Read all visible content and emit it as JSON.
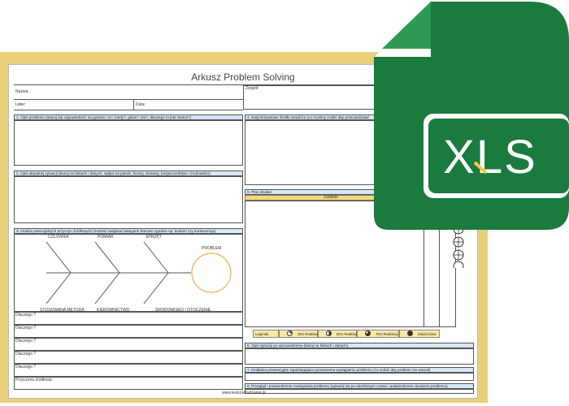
{
  "document": {
    "title": "Arkusz Problem Solving",
    "fields": {
      "nazwa": "Nazwa:",
      "zespol": "Zespół:",
      "lider": "Lider:",
      "data": "Data:"
    },
    "sections": {
      "s1": "1. Opis problemu (stanuj się odpowiedzieć na pytania: co?, kiedy?, gdzie?, kto?, dlaczego to jest istotne?)",
      "s2": "2. Opis aktualnej sytuacji (bazuj na faktach i danych, wpływ na jakość, koszty, dostawy, bezpieczeństwo i środowisko)",
      "s3": "3. Analiza potencjalnych przyczyn źródłowych (możesz nadpisać kategorie bazowe zgodnie np. kudzeń czy konkurencja)",
      "s4": "4. Natychmiastowe środki zaradcze (co musimy zrobić aby przeciwdziałać",
      "s5": "5. Plan działań",
      "s6": "6. Opis sytuacji po wprowadzeniu (bazuj na faktach i danych)",
      "s7": "7. Działania prewencyjne zapobiegające ponownemu wystąpieniu problemu (co zrobić aby problem nie wracał)",
      "s8": "8. Przegląd i potwierdzenie rozwiązania problemu (upewnij się po określonym czasie i potwierdzenie usunięcia problemu)"
    },
    "fishbone": {
      "top_labels": [
        "CZŁOWIEK",
        "POMIAR",
        "SPRZĘT"
      ],
      "bottom_labels": [
        "STOSOWANA METODA",
        "KIEROWNICTWO",
        "ŚRODOWISKO I OTOCZENIE"
      ],
      "head_label": "PROBLEM"
    },
    "why_rows": [
      "Dlaczego ?",
      "Dlaczego ?",
      "Dlaczego ?",
      "Dlaczego ?",
      "Dlaczego ?"
    ],
    "root_cause": "Przyczyna źródłowa:",
    "plan": {
      "header": "Zadanie",
      "legend": [
        "Legenda",
        "25% Realizacji",
        "50% Realizacji",
        "75% Realizacji",
        "Zakończone"
      ]
    },
    "footer_link": "www.leanzarzadzanie.pl"
  },
  "file_icon": {
    "label": "XLS",
    "color_dark": "#1b7a3e",
    "color_light": "#22a455",
    "accent": "#f2c94c"
  },
  "colors": {
    "frame": "#e9cf7a",
    "section_header": "#d6e7f6",
    "plan_header": "#f4d87a",
    "fishbone_head": "#e8b04a"
  }
}
